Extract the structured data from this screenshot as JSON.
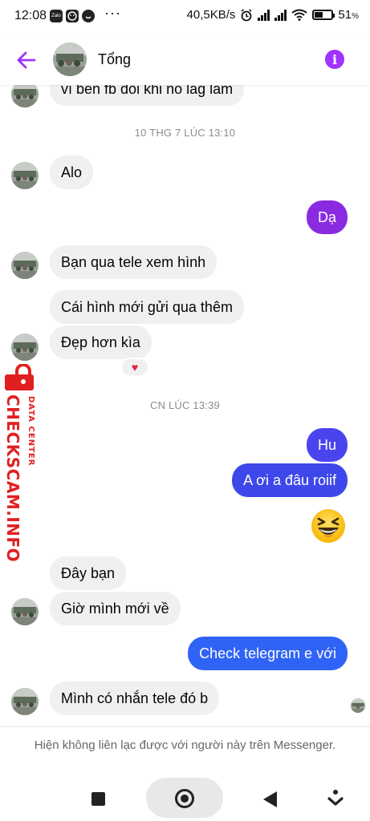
{
  "status_bar": {
    "time": "12:08",
    "notifications": [
      "Zalo",
      "messenger",
      "zalo-sticker"
    ],
    "speed": "40,5KB/s",
    "battery_percent": "51",
    "battery_level": 0.51,
    "percent_sign": "%"
  },
  "header": {
    "contact_name": "Tổng",
    "back_icon": "arrow-left-icon",
    "info_icon": "info-icon",
    "accent": "#a033ff"
  },
  "messages": {
    "m0": "vì bên fb đôi khi nó lag lắm",
    "ts1": "10 THG 7 LÚC 13:10",
    "m1": "Alo",
    "m2": "Dạ",
    "m3": "Bạn qua tele xem hình",
    "m4": "Cái hình mới gửi qua thêm",
    "m5": "Đẹp hơn kìa",
    "m5_reaction": "♥",
    "ts2": "CN LÚC 13:39",
    "m6": "Hu",
    "m7": "A ơi a đâu roiif",
    "m8_emoji": "laughing-squinting-face",
    "m9": "Đây bạn",
    "m10": "Giờ mình mới về",
    "m11": "Check telegram e với",
    "m12": "Mình có nhắn tele đó b"
  },
  "watermark": {
    "main": "CHECKSCAM.INFO",
    "sub": "DATA CENTER"
  },
  "footer": {
    "notice": "Hiện không liên lạc được với người này trên Messenger."
  },
  "colors": {
    "incoming_bubble": "#f0f0f0",
    "outgoing_purple": "#8a2be2",
    "outgoing_blue": "#2f63f5",
    "outgoing_mid": "#3e47ea",
    "watermark_red": "#e02020"
  }
}
